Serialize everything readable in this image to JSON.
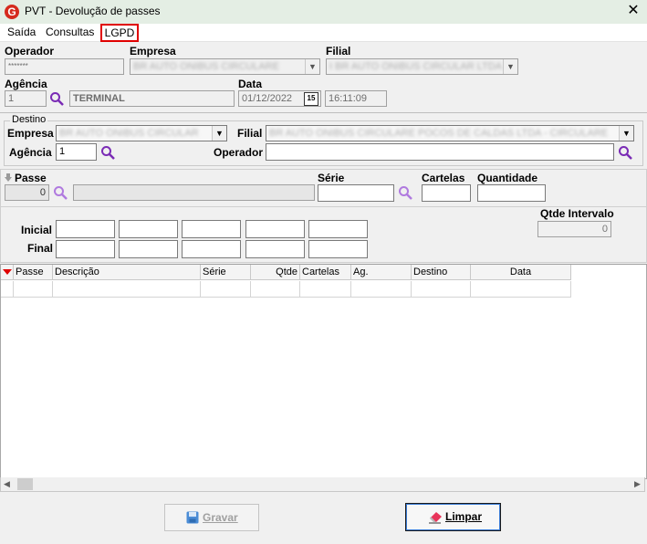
{
  "window": {
    "title": "PVT - Devolução de passes",
    "logo_letter": "G",
    "close_glyph": "✕"
  },
  "menu": {
    "items": [
      "Saída",
      "Consultas",
      "LGPD"
    ]
  },
  "header": {
    "operador_label": "Operador",
    "operador_value": "*******",
    "empresa_label": "Empresa",
    "empresa_value": "BR AUTO ONIBUS CIRCULARE",
    "filial_label": "Filial",
    "filial_value": "I  BR AUTO ONIBUS CIRCULAR LTDA",
    "agencia_label": "Agência",
    "agencia_value": "1",
    "terminal_value": "TERMINAL",
    "data_label": "Data",
    "date_value": "01/12/2022",
    "time_value": "16:11:09",
    "calendar_icon_text": "15"
  },
  "destino": {
    "group_label": "Destino",
    "empresa_label": "Empresa",
    "empresa_value": "BR AUTO ONIBUS CIRCULAR",
    "filial_label": "Filial",
    "filial_value": "BR AUTO ONIBUS CIRCULARE POCOS DE CALDAS LTDA - CIRCULARE",
    "agencia_label": "Agência",
    "agencia_value": "1",
    "operador_label": "Operador",
    "operador_value": ""
  },
  "passe": {
    "passe_label": "Passe",
    "passe_value": "0",
    "descricao_value": "",
    "serie_label": "Série",
    "cartelas_label": "Cartelas",
    "quantidade_label": "Quantidade"
  },
  "intervalo": {
    "inicial_label": "Inicial",
    "final_label": "Final",
    "qtde_label": "Qtde Intervalo",
    "qtde_value": "0"
  },
  "grid": {
    "columns": [
      "Passe",
      "Descrição",
      "Série",
      "Qtde",
      "Cartelas",
      "Ag.",
      "Destino",
      "Data"
    ]
  },
  "buttons": {
    "gravar": "Gravar",
    "limpar": "Limpar"
  },
  "colors": {
    "accent_red": "#e00000",
    "magnifier_purple": "#7a2bb5",
    "logo_red": "#d52b1e"
  }
}
